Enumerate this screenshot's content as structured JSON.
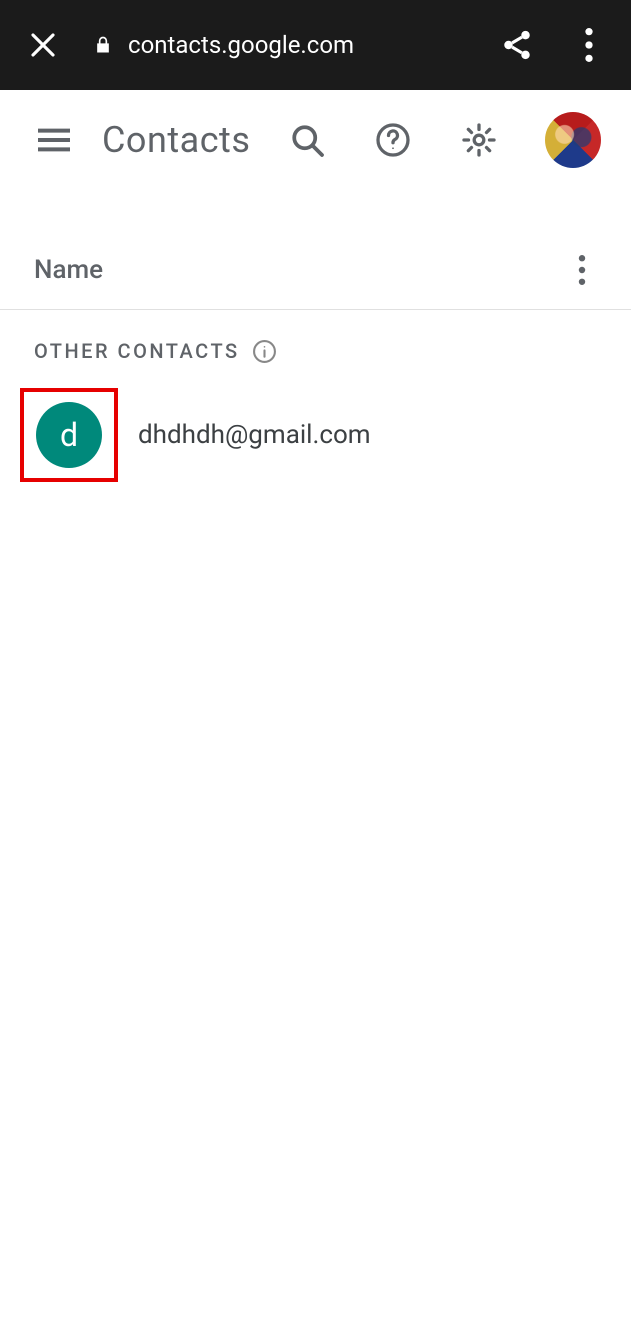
{
  "browser": {
    "url": "contacts.google.com"
  },
  "header": {
    "title": "Contacts"
  },
  "list_header": {
    "name_label": "Name"
  },
  "section": {
    "label": "OTHER CONTACTS"
  },
  "contacts": [
    {
      "initial": "d",
      "email": "dhdhdh@gmail.com",
      "avatar_color": "#00897b"
    }
  ]
}
